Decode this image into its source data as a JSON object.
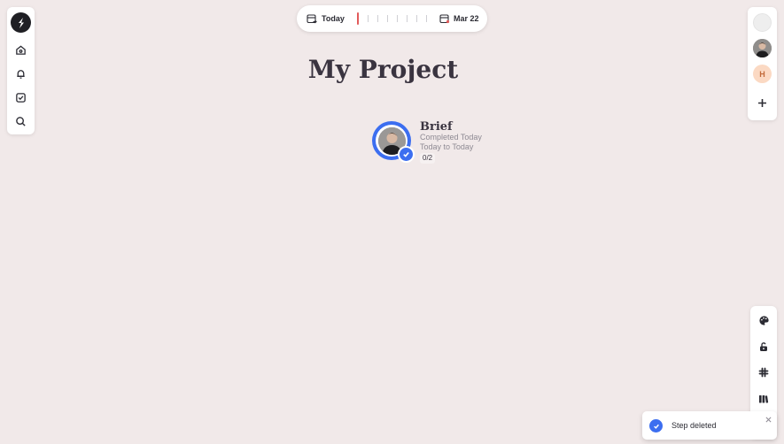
{
  "timeline": {
    "start_label": "Today",
    "end_label": "Mar 22",
    "now_marker_color": "#e25b5b"
  },
  "page": {
    "title": "My Project",
    "background": "#f1e9e9"
  },
  "node": {
    "title": "Brief",
    "status": "Completed Today",
    "dates": "Today to Today",
    "steps": "0/2",
    "accent": "#3c6ef0"
  },
  "left_nav": {
    "items": [
      {
        "icon": "logo-icon"
      },
      {
        "icon": "home-icon"
      },
      {
        "icon": "bell-icon"
      },
      {
        "icon": "checkbox-icon"
      },
      {
        "icon": "search-icon"
      }
    ]
  },
  "members": {
    "h_initial": "H",
    "add_icon": "plus-icon"
  },
  "tools": [
    {
      "icon": "palette-icon"
    },
    {
      "icon": "lock-open-icon"
    },
    {
      "icon": "slack-icon"
    },
    {
      "icon": "library-icon"
    }
  ],
  "toast": {
    "message": "Step deleted",
    "icon": "check-circle-icon"
  }
}
